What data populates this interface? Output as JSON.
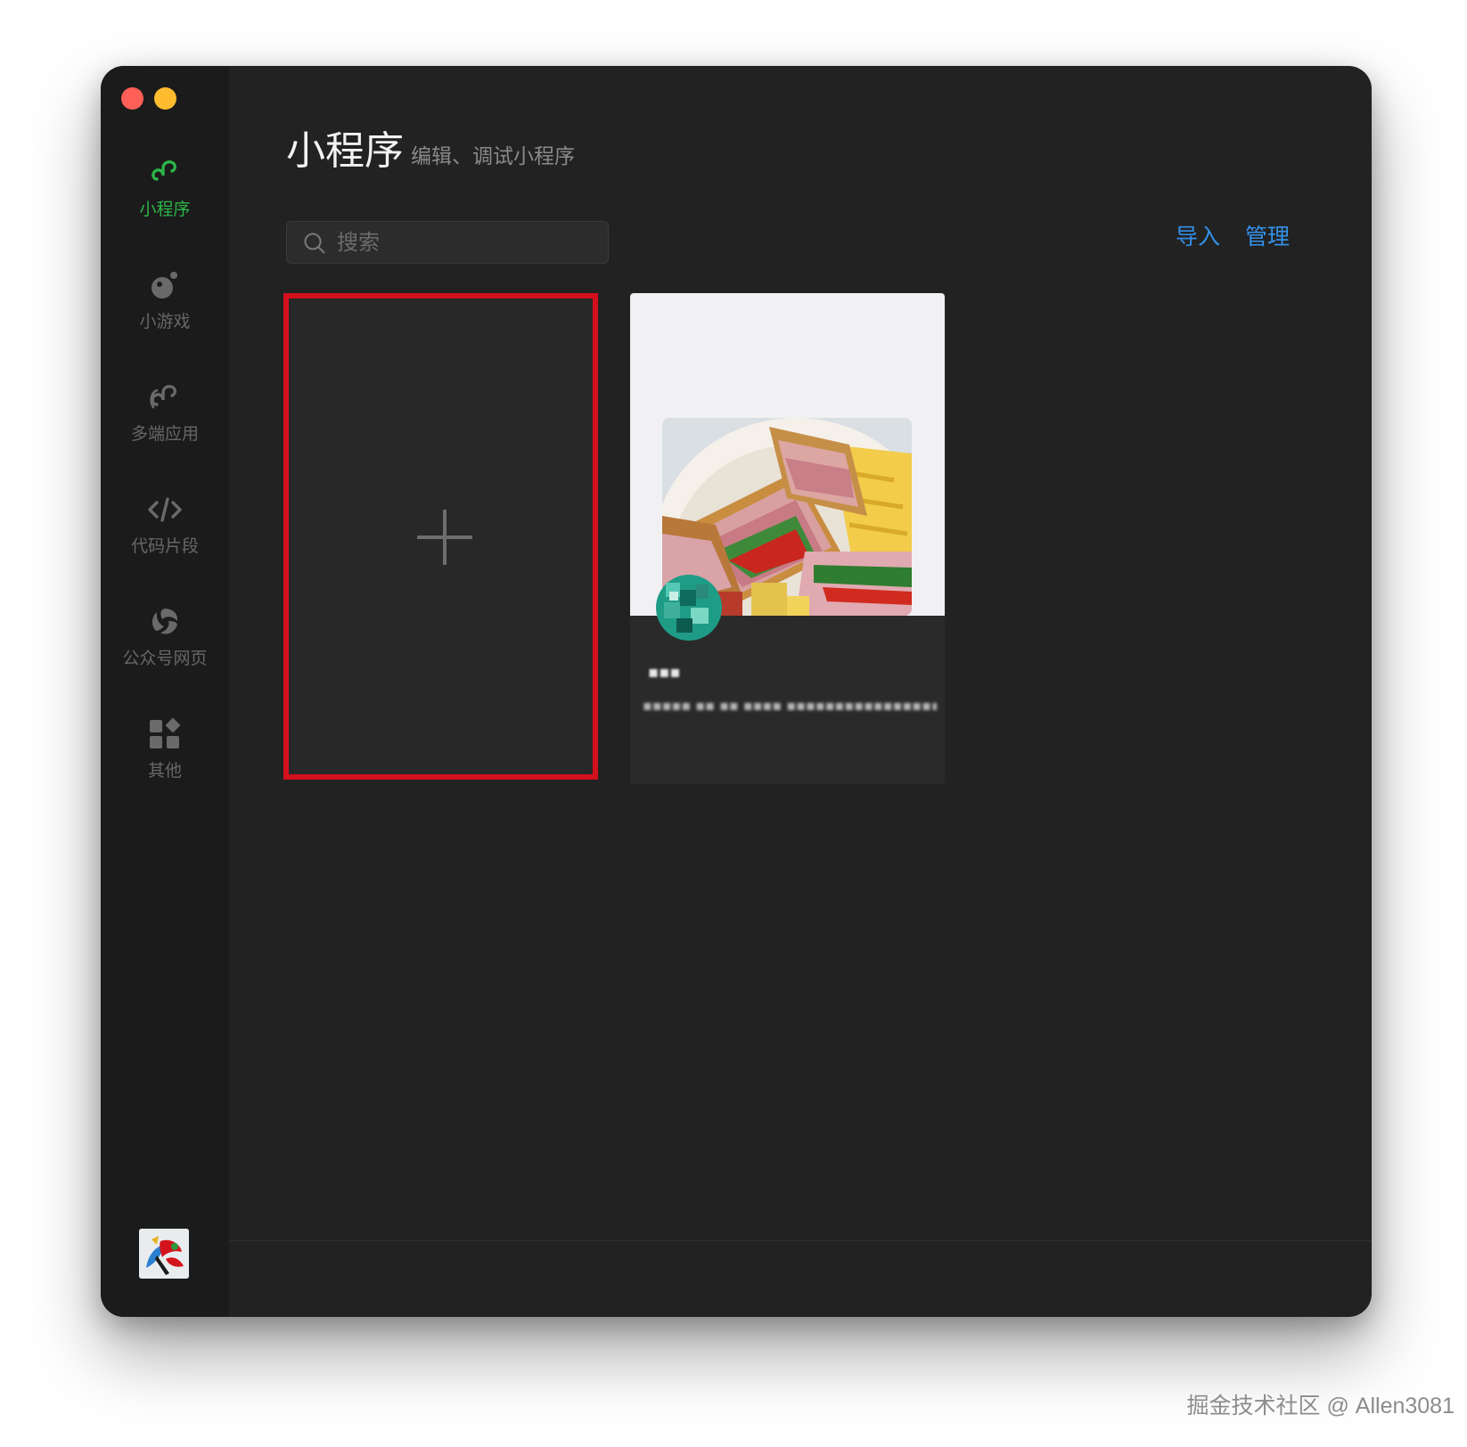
{
  "window": {
    "controls": [
      "close",
      "minimize"
    ]
  },
  "sidebar": {
    "items": [
      {
        "label": "小程序",
        "icon": "mini-program-icon",
        "active": true
      },
      {
        "label": "小游戏",
        "icon": "mini-game-icon",
        "active": false
      },
      {
        "label": "多端应用",
        "icon": "multi-platform-icon",
        "active": false
      },
      {
        "label": "代码片段",
        "icon": "code-snippet-icon",
        "active": false
      },
      {
        "label": "公众号网页",
        "icon": "official-account-icon",
        "active": false
      },
      {
        "label": "其他",
        "icon": "other-apps-icon",
        "active": false
      }
    ],
    "active_color": "#2db548",
    "inactive_color": "#676767"
  },
  "header": {
    "title": "小程序",
    "subtitle": "编辑、调试小程序"
  },
  "search": {
    "placeholder": "搜索",
    "value": ""
  },
  "actions": {
    "import_label": "导入",
    "manage_label": "管理",
    "link_color": "#3390e8"
  },
  "new_project": {
    "icon": "plus-icon",
    "highlight_color": "#d4101c"
  },
  "projects": [
    {
      "name": "▪▪▪",
      "description": "▪▪▪▪▪ ▪▪ ▪▪ ▪▪▪▪ ▪▪▪▪▪▪▪▪▪▪▪▪▪▪▪▪▪▪",
      "preview": "sandwich-photo"
    }
  ],
  "watermark": "掘金技术社区 @ Allen3081"
}
